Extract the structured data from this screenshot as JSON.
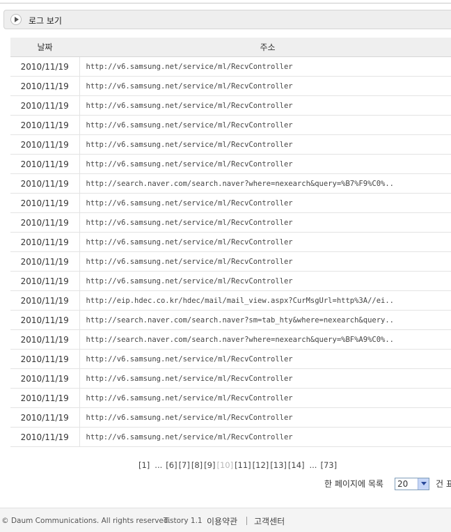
{
  "panel": {
    "title": "로그 보기"
  },
  "table": {
    "headers": [
      "날짜",
      "주소"
    ],
    "rows": [
      {
        "date": "2010/11/19",
        "url": "http://v6.samsung.net/service/ml/RecvController"
      },
      {
        "date": "2010/11/19",
        "url": "http://v6.samsung.net/service/ml/RecvController"
      },
      {
        "date": "2010/11/19",
        "url": "http://v6.samsung.net/service/ml/RecvController"
      },
      {
        "date": "2010/11/19",
        "url": "http://v6.samsung.net/service/ml/RecvController"
      },
      {
        "date": "2010/11/19",
        "url": "http://v6.samsung.net/service/ml/RecvController"
      },
      {
        "date": "2010/11/19",
        "url": "http://v6.samsung.net/service/ml/RecvController"
      },
      {
        "date": "2010/11/19",
        "url": "http://search.naver.com/search.naver?where=nexearch&query=%B7%F9%C0%.."
      },
      {
        "date": "2010/11/19",
        "url": "http://v6.samsung.net/service/ml/RecvController"
      },
      {
        "date": "2010/11/19",
        "url": "http://v6.samsung.net/service/ml/RecvController"
      },
      {
        "date": "2010/11/19",
        "url": "http://v6.samsung.net/service/ml/RecvController"
      },
      {
        "date": "2010/11/19",
        "url": "http://v6.samsung.net/service/ml/RecvController"
      },
      {
        "date": "2010/11/19",
        "url": "http://v6.samsung.net/service/ml/RecvController"
      },
      {
        "date": "2010/11/19",
        "url": "http://eip.hdec.co.kr/hdec/mail/mail_view.aspx?CurMsgUrl=http%3A//ei.."
      },
      {
        "date": "2010/11/19",
        "url": "http://search.naver.com/search.naver?sm=tab_hty&where=nexearch&query.."
      },
      {
        "date": "2010/11/19",
        "url": "http://search.naver.com/search.naver?where=nexearch&query=%BF%A9%C0%.."
      },
      {
        "date": "2010/11/19",
        "url": "http://v6.samsung.net/service/ml/RecvController"
      },
      {
        "date": "2010/11/19",
        "url": "http://v6.samsung.net/service/ml/RecvController"
      },
      {
        "date": "2010/11/19",
        "url": "http://v6.samsung.net/service/ml/RecvController"
      },
      {
        "date": "2010/11/19",
        "url": "http://v6.samsung.net/service/ml/RecvController"
      },
      {
        "date": "2010/11/19",
        "url": "http://v6.samsung.net/service/ml/RecvController"
      }
    ]
  },
  "pagination": {
    "items": [
      {
        "label": "[1]",
        "current": false
      },
      {
        "label": "...",
        "current": false
      },
      {
        "label": "[6]",
        "current": false
      },
      {
        "label": "[7]",
        "current": false
      },
      {
        "label": "[8]",
        "current": false
      },
      {
        "label": "[9]",
        "current": false
      },
      {
        "label": "[10]",
        "current": true
      },
      {
        "label": "[11]",
        "current": false
      },
      {
        "label": "[12]",
        "current": false
      },
      {
        "label": "[13]",
        "current": false
      },
      {
        "label": "[14]",
        "current": false
      },
      {
        "label": "...",
        "current": false
      },
      {
        "label": "[73]",
        "current": false
      }
    ]
  },
  "per_page": {
    "label": "한 페이지에 목록",
    "value": "20",
    "unit": "건 표"
  },
  "footer": {
    "copyright": "ht © Daum Communications. All rights reserved.",
    "version": "Tistory 1.1",
    "terms": "이용약관",
    "support": "고객센터"
  },
  "icons": {
    "panel_toggle": "play-icon",
    "select_arrow": "chevron-down-icon"
  }
}
